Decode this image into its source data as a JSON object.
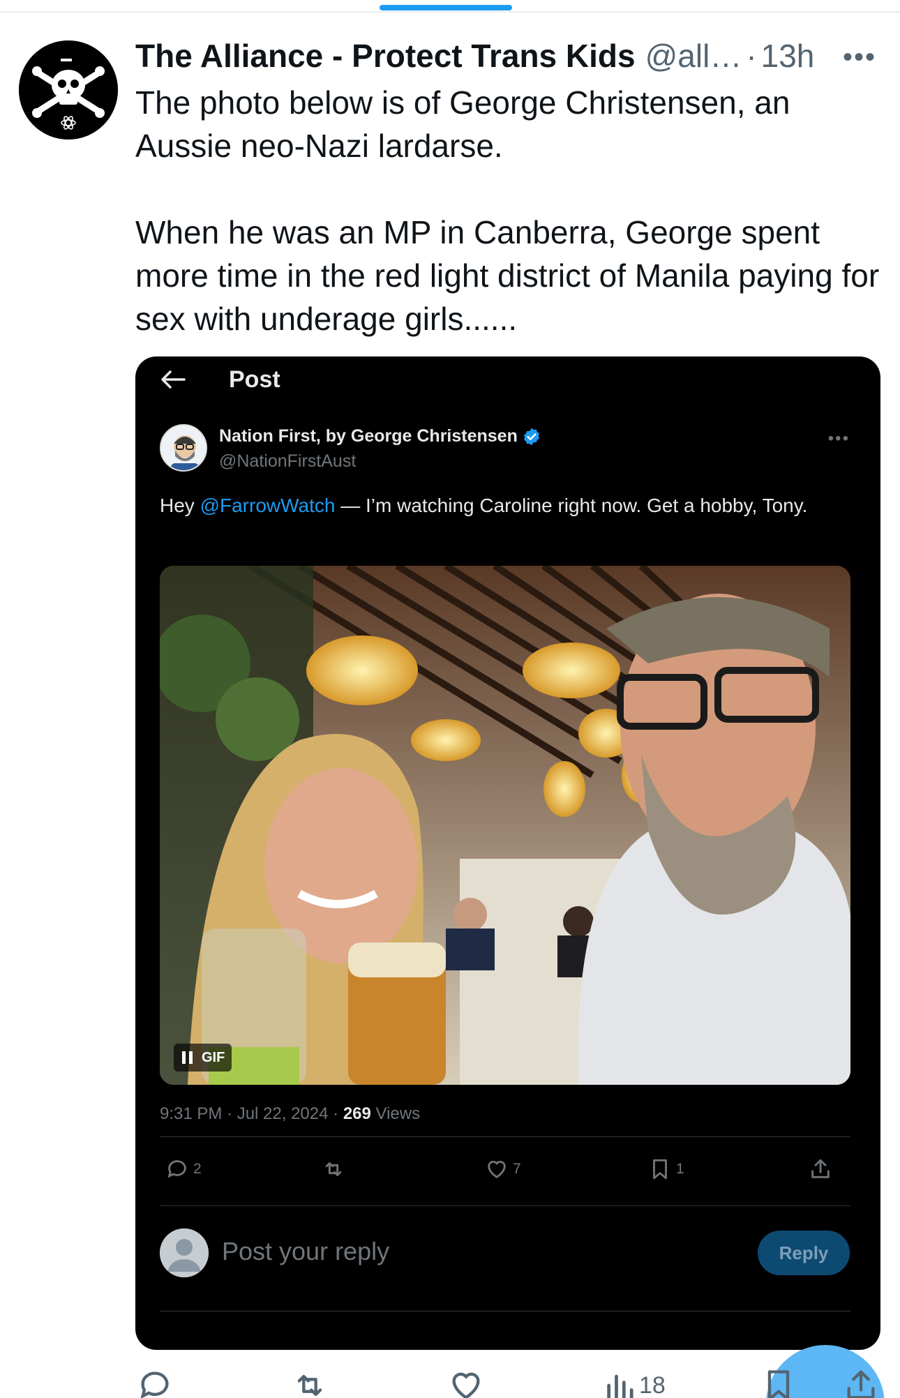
{
  "tweet": {
    "author_name": "The Alliance - Protect Trans Kids",
    "handle": "@all…",
    "separator": "·",
    "time": "13h",
    "more": "•••",
    "paragraphs": [
      "The photo below is of George Christensen, an Aussie neo-Nazi lardarse.",
      "When he was an MP in Canberra, George spent more time in the red light district of Manila paying for sex with underage girls......"
    ],
    "avatar_icon": "skull-crossbones-icon"
  },
  "embed": {
    "header_title": "Post",
    "author_name": "Nation First, by George Christensen",
    "handle": "@NationFirstAust",
    "more": "•••",
    "text_prefix": "Hey ",
    "mention": "@FarrowWatch",
    "text_suffix": " — I’m watching Caroline right now. Get a hobby, Tony.",
    "gif_label": "GIF",
    "meta_time": "9:31 PM · Jul 22, 2024 · ",
    "views_count": "269",
    "views_label": " Views",
    "counts": {
      "replies": "2",
      "likes": "7",
      "bookmarks": "1"
    },
    "reply_placeholder": "Post your reply",
    "reply_button": "Reply"
  },
  "bottom_bar": {
    "views_count": "18"
  },
  "colors": {
    "accent": "#1d9bf0",
    "embed_bg": "#000000",
    "muted": "#536471"
  }
}
